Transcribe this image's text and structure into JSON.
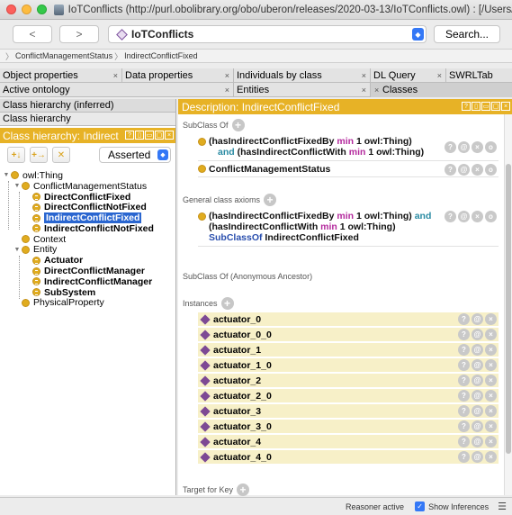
{
  "window": {
    "title": "IoTConflicts (http://purl.obolibrary.org/obo/uberon/releases/2020-03-13/IoTConflicts.owl) : [/Users/grocher/D..."
  },
  "toolbar": {
    "back": "<",
    "forward": ">",
    "ontology": "IoTConflicts",
    "search_label": "Search..."
  },
  "breadcrumb": [
    "ConflictManagementStatus",
    "IndirectConflictFixed"
  ],
  "tabs_row1": [
    {
      "label": "Object properties"
    },
    {
      "label": "Data properties"
    },
    {
      "label": "Individuals by class"
    },
    {
      "label": "DL Query"
    },
    {
      "label": "SWRLTab"
    }
  ],
  "tabs_row2": [
    {
      "label": "Active ontology"
    },
    {
      "label": "Entities"
    },
    {
      "label": "Classes"
    }
  ],
  "left": {
    "header_inferred": "Class hierarchy (inferred)",
    "header": "Class hierarchy",
    "gold_title": "Class hierarchy: Indirect",
    "selector": "Asserted",
    "tree": [
      {
        "label": "owl:Thing"
      },
      {
        "label": "ConflictManagementStatus"
      },
      {
        "label": "DirectConflictFixed"
      },
      {
        "label": "DirectConflictNotFixed"
      },
      {
        "label": "IndirectConflictFixed"
      },
      {
        "label": "IndirectConflictNotFixed"
      },
      {
        "label": "Context"
      },
      {
        "label": "Entity"
      },
      {
        "label": "Actuator"
      },
      {
        "label": "DirectConflictManager"
      },
      {
        "label": "IndirectConflictManager"
      },
      {
        "label": "SubSystem"
      },
      {
        "label": "PhysicalProperty"
      }
    ]
  },
  "right": {
    "gold_title": "Description: IndirectConflictFixed",
    "subclass_of_label": "SubClass Of",
    "subclass_expr": {
      "p1_open": "(hasIndirectConflictFixedBy ",
      "p1_min": "min",
      "p1_rest": " 1 owl:Thing)",
      "p2_and": "and",
      "p2_prop": " (hasIndirectConflictWith ",
      "p2_min": "min",
      "p2_rest": " 1 owl:Thing)"
    },
    "subclass_named": "ConflictManagementStatus",
    "gca_label": "General class axioms",
    "gca_expr": {
      "p1_open": "(hasIndirectConflictFixedBy ",
      "p1_min": "min",
      "p1_rest": " 1 owl:Thing) ",
      "p1_and": "and",
      "p2_prop": "(hasIndirectConflictWith ",
      "p2_min": "min",
      "p2_rest": " 1 owl:Thing)",
      "p3_kw": "SubClassOf",
      "p3_rest": " IndirectConflictFixed"
    },
    "anon_label": "SubClass Of (Anonymous Ancestor)",
    "instances_label": "Instances",
    "instances": [
      "actuator_0",
      "actuator_0_0",
      "actuator_1",
      "actuator_1_0",
      "actuator_2",
      "actuator_2_0",
      "actuator_3",
      "actuator_3_0",
      "actuator_4",
      "actuator_4_0"
    ],
    "target_label": "Target for Key"
  },
  "status": {
    "reasoner": "Reasoner active",
    "show_inferences": "Show Inferences"
  }
}
